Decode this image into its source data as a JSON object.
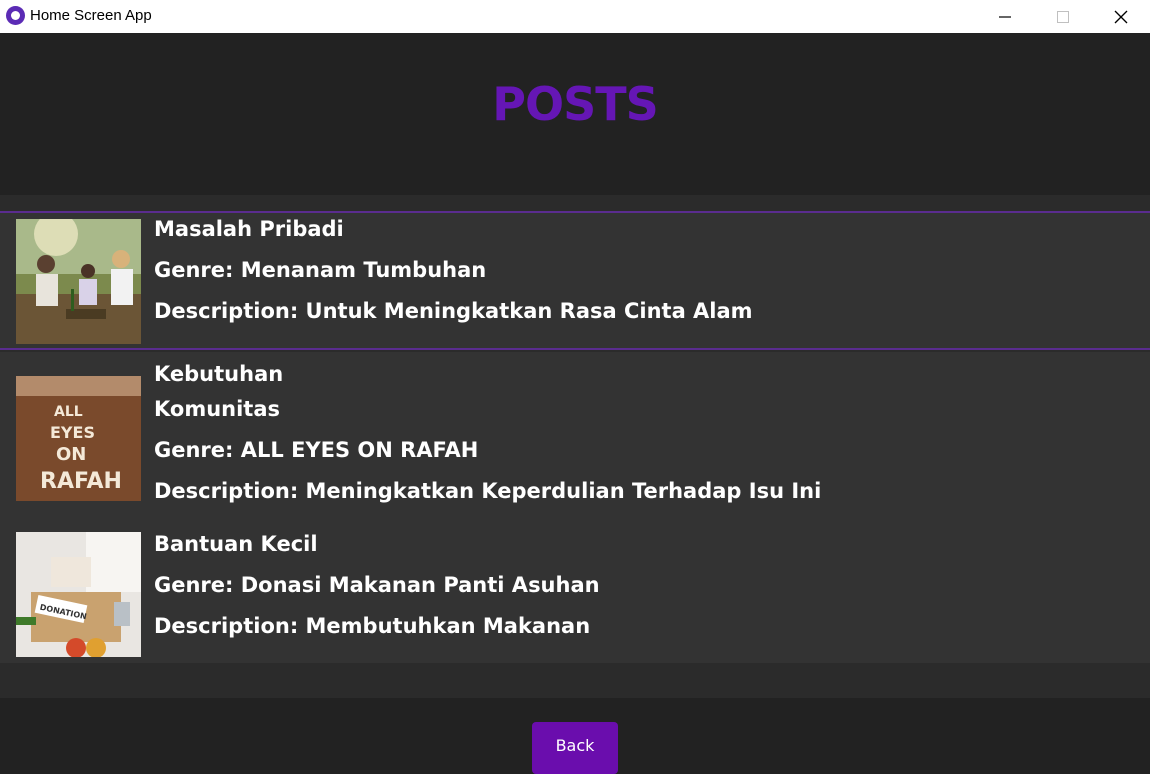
{
  "window": {
    "title": "Home Screen App",
    "icons": {
      "app": "app-logo-icon",
      "minimize": "minimize-icon",
      "maximize": "maximize-icon",
      "close": "close-icon"
    }
  },
  "header": {
    "title": "POSTS",
    "title_color": "#6516b5"
  },
  "posts": [
    {
      "title_lines": [
        "Masalah Pribadi"
      ],
      "genre": "Genre: Menanam Tumbuhan",
      "description": "Description: Untuk Meningkatkan Rasa Cinta Alam",
      "image": "family-planting-photo"
    },
    {
      "title_lines": [
        "Kebutuhan",
        "Komunitas"
      ],
      "genre": "Genre: ALL EYES ON RAFAH",
      "description": "Description: Meningkatkan  Keperdulian Terhadap Isu Ini",
      "image": "all-eyes-on-rafah-photo",
      "image_text": [
        "ALL",
        "EYES",
        "ON",
        "RAFAH"
      ]
    },
    {
      "title_lines": [
        "Bantuan Kecil"
      ],
      "genre": "Genre: Donasi Makanan Panti Asuhan",
      "description": "Description: Membutuhkan Makanan",
      "image": "food-donation-photo",
      "image_text": [
        "DONATION"
      ]
    }
  ],
  "footer": {
    "back_label": "Back",
    "accent": "#6a0dad"
  }
}
